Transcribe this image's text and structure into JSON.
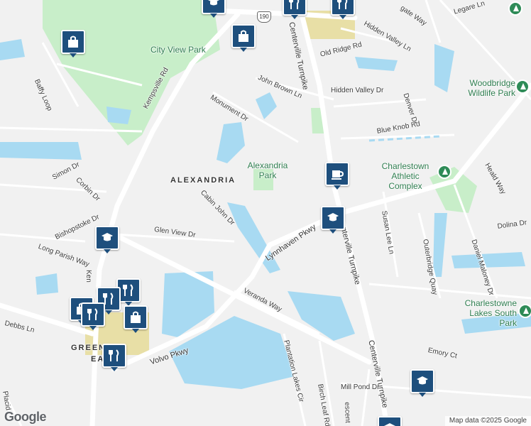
{
  "attribution": "Map data ©2025 Google",
  "logo_text": "Google",
  "route_shield": "190",
  "colors": {
    "water": "#a8daf2",
    "park": "#c8eec9",
    "road": "#ffffff",
    "land": "#f1f1f1",
    "poi": "#1e4f7d",
    "park_icon": "#2e8b57"
  },
  "areas": {
    "alexandria": "ALEXANDRIA",
    "greenbrier_1": "GREENB",
    "greenbrier_2": "EA"
  },
  "parks": {
    "city_view": "City View Park",
    "alexandria": "Alexandria Park",
    "charlestown": "Charlestown Athletic Complex",
    "woodbridge": "Woodbridge Wildlife Park",
    "charlestowne_lakes": "Charlestowne Lakes South Park"
  },
  "streets": {
    "kempsville_1": "Kempsville Rd",
    "kempsville_2": "Ken",
    "centerville_1": "Centerville Turnpike",
    "centerville_2": "Centerville Turnpike",
    "centerville_3": "Centerville Turnpike",
    "lynnhaven": "Lynnhaven Pkwy",
    "volvo": "Volvo Pkwy",
    "veranda": "Veranda Way",
    "plantation": "Plantation Lakes Cir",
    "mill_pond": "Mill Pond Dr",
    "birch_leaf": "Birch Leaf Rd",
    "crescent": "escent",
    "emory": "Emory Ct",
    "daniel_maloney": "Daniel Maloney Dr",
    "outerbridge": "Outerbridge Quay",
    "susan_lee": "Susan Lee Ln",
    "dolina": "Dolina Dr",
    "heald": "Heald Way",
    "blue_knob": "Blue Knob Rd",
    "denver": "Denver Dr",
    "hidden_valley_dr": "Hidden Valley Dr",
    "hidden_valley_ln": "Hidden Valley Ln",
    "old_ridge": "Old Ridge Rd",
    "legare": "Legare Ln",
    "wingate": "gate Way",
    "john_brown": "John Brown Ln",
    "monument": "Monument Dr",
    "cabin_john": "Cabin John Dr",
    "glen_view": "Glen View Dr",
    "simon": "Simon Dr",
    "corbin": "Corbin Dr",
    "bishopstoke": "Bishopstoke Dr",
    "long_parish": "Long Parish Way",
    "debbs": "Debbs Ln",
    "baffy": "Baffy Loop",
    "placid": "Placid"
  },
  "pois": [
    {
      "type": "school-icon"
    },
    {
      "type": "restaurant-icon"
    },
    {
      "type": "restaurant-icon"
    },
    {
      "type": "shopping-bag-icon"
    },
    {
      "type": "shopping-bag-icon"
    },
    {
      "type": "cafe-icon"
    },
    {
      "type": "school-icon"
    },
    {
      "type": "school-icon"
    },
    {
      "type": "restaurant-icon"
    },
    {
      "type": "restaurant-icon"
    },
    {
      "type": "shopping-bag-icon"
    },
    {
      "type": "restaurant-icon"
    },
    {
      "type": "school-icon"
    },
    {
      "type": "school-icon"
    },
    {
      "type": "shopping-bag-icon"
    }
  ]
}
